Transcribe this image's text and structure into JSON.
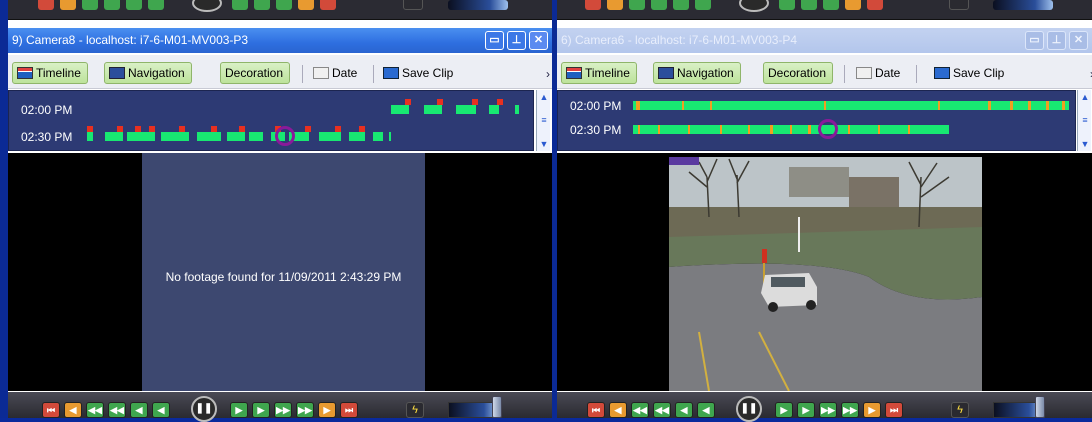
{
  "panes": [
    {
      "title": "9) Camera8 - localhost: i7-6-M01-MV003-P3",
      "active": true,
      "toolbar": {
        "timeline_label": "Timeline",
        "navigation_label": "Navigation",
        "decoration_label": "Decoration",
        "date_label": "Date",
        "save_clip_label": "Save Clip"
      },
      "timeline": {
        "row1_time": "02:00 PM",
        "row2_time": "02:30 PM"
      },
      "message": "No footage found for 11/09/2011 2:43:29 PM"
    },
    {
      "title": "6) Camera6 - localhost: i7-6-M01-MV003-P4",
      "active": false,
      "toolbar": {
        "timeline_label": "Timeline",
        "navigation_label": "Navigation",
        "decoration_label": "Decoration",
        "date_label": "Date",
        "save_clip_label": "Save Clip"
      },
      "timeline": {
        "row1_time": "02:00 PM",
        "row2_time": "02:30 PM"
      }
    }
  ],
  "icons": {
    "minimize": "minimize-icon",
    "pin": "pin-icon",
    "close": "close-icon",
    "more": "chevron-right-icon"
  },
  "colors": {
    "recording": "#18e872",
    "motion": "#f0a020",
    "event": "#e83020",
    "cursor": "#8a1a9a"
  }
}
